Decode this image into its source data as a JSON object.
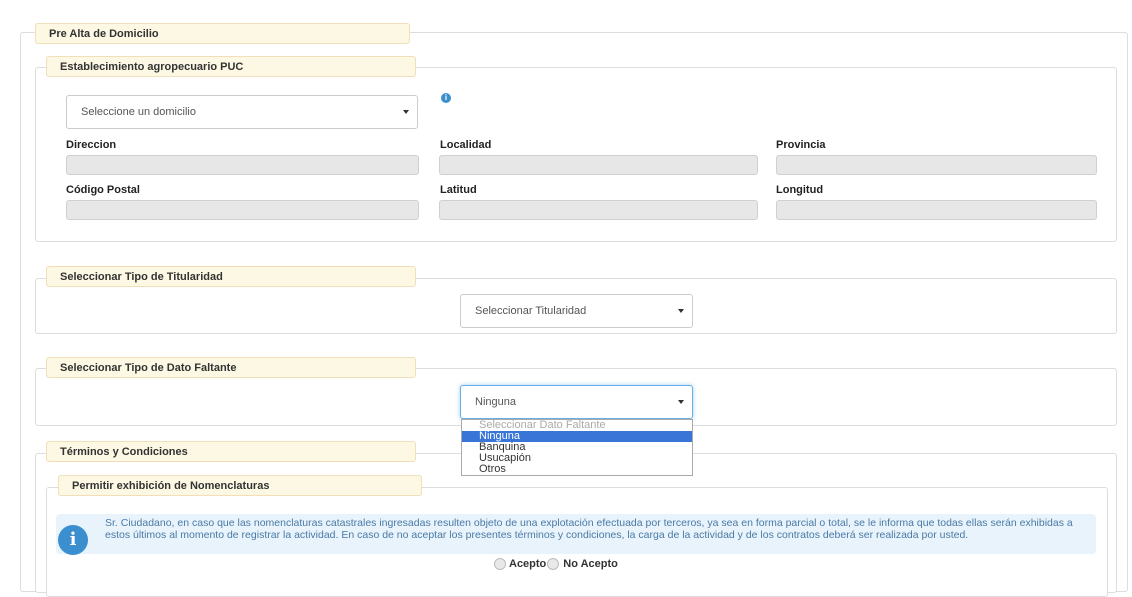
{
  "outer": {
    "legend": "Pre Alta de Domicilio"
  },
  "establishment": {
    "legend": "Establecimiento agropecuario PUC",
    "select_value": "Seleccione un domicilio",
    "fields": {
      "direccion": "Direccion",
      "localidad": "Localidad",
      "provincia": "Provincia",
      "codigo_postal": "Código Postal",
      "latitud": "Latitud",
      "longitud": "Longitud"
    }
  },
  "titularidad": {
    "legend": "Seleccionar Tipo de Titularidad",
    "select_value": "Seleccionar Titularidad"
  },
  "dato_faltante": {
    "legend": "Seleccionar Tipo de Dato Faltante",
    "select_value": "Ninguna",
    "options": [
      "Seleccionar Dato Faltante",
      "Ninguna",
      "Banquina",
      "Usucapión",
      "Otros"
    ]
  },
  "terminos": {
    "legend": "Términos y Condiciones",
    "sub_legend": "Permitir exhibición de Nomenclaturas",
    "info_text": "Sr. Ciudadano, en caso que las nomenclaturas catastrales ingresadas resulten objeto de una explotación efectuada por terceros, ya sea en forma parcial o total, se le informa que todas ellas serán exhibidas a estos últimos al momento de registrar la actividad. En caso de no aceptar los presentes términos y condiciones, la carga de la actividad y de los contratos deberá ser realizada por usted.",
    "accept": "Acepto",
    "not_accept": "No Acepto"
  },
  "colors": {
    "legend_bg": "#fcf8e3",
    "info_bg": "#e8f3fb",
    "info_text": "#4a7aa6",
    "selected_option": "#3875d7"
  }
}
